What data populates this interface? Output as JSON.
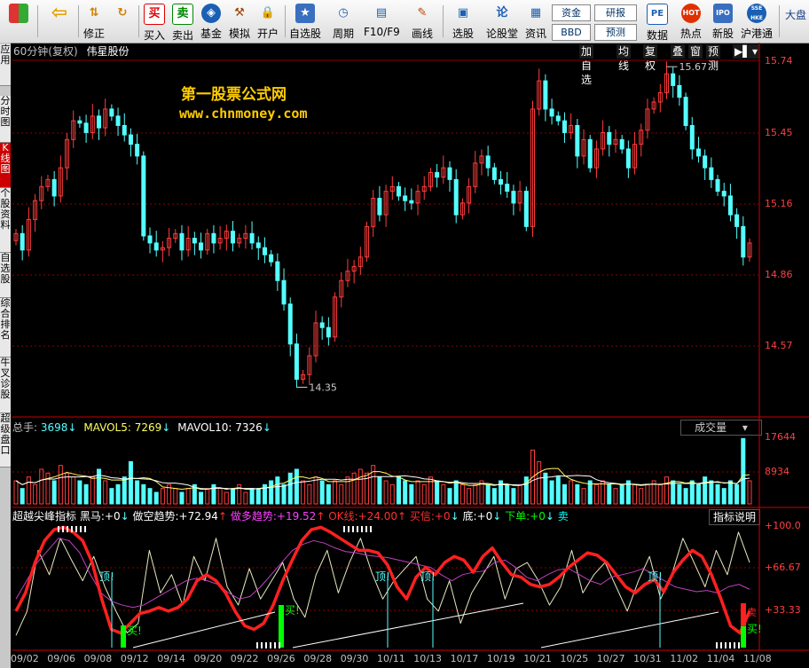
{
  "toolbar": {
    "items": [
      {
        "label": "",
        "icon": "grid-icon"
      },
      {
        "label": "",
        "icon": "back-arrow-icon"
      },
      {
        "label": "修正",
        "icon": "updown-icon"
      },
      {
        "label": "",
        "icon": "refresh-icon"
      },
      {
        "label": "买入",
        "icon": "buy-icon",
        "glyph": "买"
      },
      {
        "label": "卖出",
        "icon": "sell-icon",
        "glyph": "卖"
      },
      {
        "label": "基金",
        "icon": "fund-icon"
      },
      {
        "label": "模拟",
        "icon": "hammer-icon"
      },
      {
        "label": "开户",
        "icon": "lock-icon"
      },
      {
        "label": "自选股",
        "icon": "star-icon"
      },
      {
        "label": "周期",
        "icon": "clock-icon"
      },
      {
        "label": "F10/F9",
        "icon": "f10-icon"
      },
      {
        "label": "画线",
        "icon": "pencil-icon"
      },
      {
        "label": "选股",
        "icon": "monitor-icon"
      },
      {
        "label": "论股堂",
        "icon": "discuss-icon"
      },
      {
        "label": "资讯",
        "icon": "news-icon"
      },
      {
        "label": "数据",
        "icon": "pe-icon",
        "glyph": "PE"
      },
      {
        "label": "热点",
        "icon": "hot-icon",
        "glyph": "HOT"
      },
      {
        "label": "新股",
        "icon": "ipo-icon",
        "glyph": "IPO"
      },
      {
        "label": "沪港通",
        "icon": "sse-hke-icon",
        "glyph": "SSE HKE"
      },
      {
        "label": "大盘",
        "icon": ""
      }
    ],
    "boxes": {
      "capital": "资金",
      "bbd": "BBD",
      "research": "研报",
      "forecast": "预测"
    }
  },
  "sidebar": [
    {
      "label": "应用"
    },
    {
      "label": "分时图"
    },
    {
      "label": "K线图",
      "active": true
    },
    {
      "label": "个股资料"
    },
    {
      "label": "自选股"
    },
    {
      "label": "综合排名"
    },
    {
      "label": "牛叉诊股"
    },
    {
      "label": "超级盘口"
    }
  ],
  "chart_title": {
    "period": "60分钟(复权)",
    "stock": "伟星股份"
  },
  "top_buttons": [
    "加自选",
    "均线",
    "复权",
    "叠",
    "窗",
    "预测"
  ],
  "watermark": {
    "title": "第一股票公式网",
    "url": "www.chnmoney.com"
  },
  "price_axis": [
    "15.74",
    "15.45",
    "15.16",
    "14.86",
    "14.57"
  ],
  "annotations": {
    "high": "15.67",
    "low": "14.35"
  },
  "volume": {
    "label": "总手",
    "value": "3698",
    "arrow": "↓",
    "mavol5_label": "MAVOL5:",
    "mavol5": "7269",
    "mavol5_arrow": "↓",
    "mavol10_label": "MAVOL10:",
    "mavol10": "7326",
    "mavol10_arrow": "↓",
    "dropdown": "成交量",
    "axis": [
      "17644",
      "8934"
    ]
  },
  "indicator": {
    "name": "超越尖峰指标",
    "items": [
      {
        "label": "黑马:",
        "value": "+0",
        "arrow": "↓",
        "color": "#ffffff"
      },
      {
        "label": "做空趋势:",
        "value": "+72.94",
        "arrow": "↑",
        "color": "#ffffff"
      },
      {
        "label": "做多趋势:",
        "value": "+19.52",
        "arrow": "↑",
        "color": "#ff40ff"
      },
      {
        "label": "OK线:",
        "value": "+24.00",
        "arrow": "↑",
        "color": "#ff3030"
      },
      {
        "label": "买信:",
        "value": "+0",
        "arrow": "↓",
        "color": "#ff3030"
      },
      {
        "label": "底:",
        "value": "+0",
        "arrow": "↓",
        "color": "#ffffff"
      },
      {
        "label": "下单:",
        "value": "+0",
        "arrow": "↓",
        "color": "#00ff00"
      },
      {
        "label": "卖",
        "value": "",
        "arrow": "",
        "color": "#00ffff"
      }
    ],
    "button": "指标说明",
    "axis": [
      "+100.0",
      "+66.67",
      "+33.33"
    ],
    "signals": {
      "top": "顶!",
      "buy": "买!",
      "sell": "卖"
    }
  },
  "dates": [
    "09/02",
    "09/06",
    "09/08",
    "09/12",
    "09/14",
    "09/20",
    "09/22",
    "09/26",
    "09/28",
    "09/30",
    "10/11",
    "10/13",
    "10/17",
    "10/19",
    "10/21",
    "10/25",
    "10/27",
    "10/31",
    "11/02",
    "11/04",
    "11/08"
  ],
  "colors": {
    "up": "#ff3c3c",
    "down": "#54ffff",
    "axis": "#ff4040",
    "grid": "#8b0000"
  },
  "price_series": [
    15.02,
    14.95,
    15.08,
    15.16,
    15.22,
    15.25,
    15.18,
    15.3,
    15.42,
    15.5,
    15.49,
    15.45,
    15.52,
    15.47,
    15.55,
    15.52,
    15.48,
    15.44,
    15.4,
    15.35,
    15.01,
    14.98,
    14.95,
    14.96,
    15.0,
    15.02,
    14.95,
    15.0,
    14.98,
    14.95,
    15.02,
    14.98,
    15.0,
    15.03,
    14.98,
    15.0,
    15.02,
    14.98,
    14.96,
    14.93,
    14.9,
    14.82,
    14.72,
    14.55,
    14.4,
    14.42,
    14.5,
    14.64,
    14.62,
    14.58,
    14.75,
    14.82,
    14.86,
    14.88,
    14.92,
    15.05,
    15.17,
    15.1,
    15.2,
    15.22,
    15.18,
    15.16,
    15.15,
    15.2,
    15.22,
    15.28,
    15.26,
    15.3,
    15.25,
    15.1,
    15.15,
    15.22,
    15.32,
    15.35,
    15.3,
    15.25,
    15.23,
    15.2,
    15.15,
    15.2,
    15.05,
    15.55,
    15.67,
    15.55,
    15.52,
    15.5,
    15.45,
    15.48,
    15.35,
    15.42,
    15.3,
    15.38,
    15.45,
    15.4,
    15.42,
    15.38,
    15.3,
    15.4,
    15.46,
    15.55,
    15.58,
    15.62,
    15.7,
    15.65,
    15.6,
    15.48,
    15.38,
    15.35,
    15.3,
    15.25,
    15.2,
    15.18,
    15.1,
    15.05,
    14.92,
    14.98
  ],
  "volume_series": [
    6,
    4,
    7,
    5,
    9,
    8,
    6,
    10,
    8,
    7,
    6,
    5,
    7,
    9,
    6,
    4,
    5,
    7,
    11,
    6,
    5,
    4,
    3,
    4,
    5,
    4,
    3,
    4,
    5,
    3,
    4,
    5,
    4,
    3,
    4,
    5,
    3,
    4,
    4,
    5,
    6,
    7,
    5,
    8,
    9,
    6,
    5,
    7,
    6,
    5,
    6,
    5,
    7,
    8,
    9,
    8,
    10,
    7,
    6,
    5,
    7,
    6,
    5,
    6,
    5,
    7,
    6,
    5,
    4,
    6,
    5,
    4,
    5,
    6,
    5,
    4,
    6,
    5,
    4,
    5,
    7,
    14,
    11,
    8,
    6,
    7,
    5,
    6,
    5,
    4,
    6,
    5,
    6,
    5,
    4,
    5,
    6,
    5,
    4,
    5,
    6,
    5,
    7,
    6,
    5,
    4,
    6,
    5,
    7,
    6,
    5,
    4,
    6,
    5,
    17,
    6
  ],
  "ok_line": [
    30,
    45,
    70,
    88,
    97,
    99,
    95,
    88,
    70,
    40,
    15,
    12,
    20,
    28,
    30,
    33,
    30,
    33,
    40,
    55,
    60,
    55,
    45,
    30,
    18,
    15,
    20,
    35,
    55,
    72,
    88,
    97,
    99,
    95,
    90,
    85,
    80,
    80,
    78,
    68,
    50,
    40,
    58,
    66,
    60,
    70,
    75,
    72,
    62,
    75,
    82,
    70,
    60,
    58,
    52,
    50,
    52,
    58,
    66,
    72,
    78,
    76,
    70,
    60,
    50,
    45,
    52,
    56,
    46,
    62,
    72,
    80,
    75,
    60,
    40,
    18,
    12,
    30
  ],
  "trend_line": [
    40,
    55,
    70,
    80,
    90,
    88,
    78,
    60,
    45,
    38,
    35,
    33,
    35,
    40,
    45,
    50,
    55,
    57,
    55,
    52,
    45,
    40,
    42,
    50,
    60,
    70,
    80,
    85,
    88,
    86,
    82,
    79,
    78,
    76,
    75,
    74,
    72,
    70,
    68,
    66,
    60,
    55,
    60,
    62,
    63,
    70,
    72,
    66,
    58,
    55,
    60,
    64,
    65,
    60,
    55,
    52,
    58,
    60,
    62,
    65,
    60,
    55,
    50,
    48,
    46,
    47,
    45,
    50,
    52,
    48
  ],
  "short_line": [
    10,
    30,
    80,
    60,
    90,
    72,
    55,
    75,
    50,
    30,
    12,
    20,
    80,
    45,
    60,
    35,
    75,
    55,
    90,
    50,
    35,
    65,
    40,
    55,
    70,
    40,
    25,
    60,
    80,
    45,
    70,
    90,
    62,
    40,
    55,
    65,
    75,
    40,
    30,
    55,
    20,
    45,
    60,
    75,
    40,
    65,
    70,
    55,
    35,
    50,
    80,
    45,
    60,
    70,
    50,
    30,
    55,
    75,
    40,
    60,
    90,
    70,
    50,
    80,
    60,
    95,
    70
  ]
}
